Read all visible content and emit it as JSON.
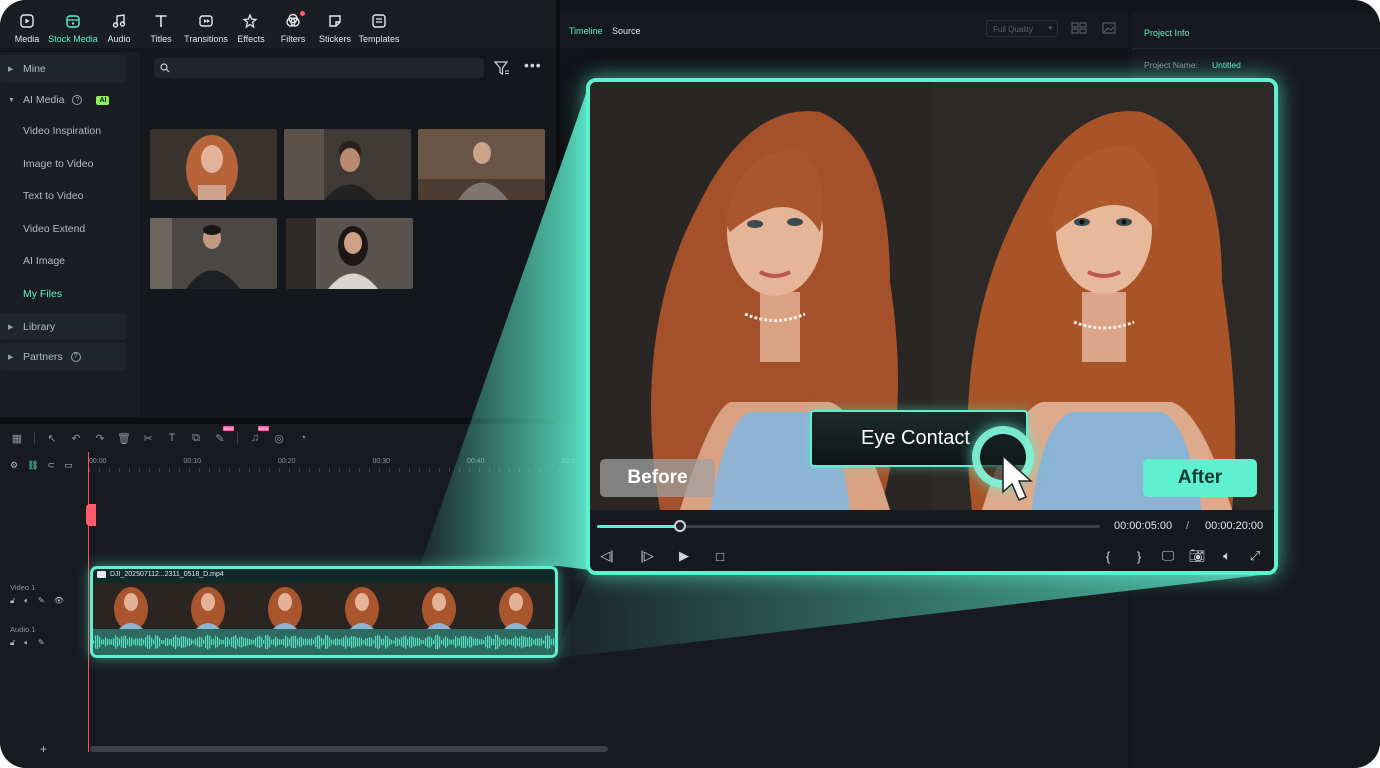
{
  "toolbar": {
    "tabs": [
      {
        "label": "Media",
        "icon": "media-icon"
      },
      {
        "label": "Stock Media",
        "icon": "stock-media-icon",
        "active": true
      },
      {
        "label": "Audio",
        "icon": "music-note-icon"
      },
      {
        "label": "Titles",
        "icon": "text-t-icon"
      },
      {
        "label": "Transitions",
        "icon": "transition-icon"
      },
      {
        "label": "Effects",
        "icon": "sparkle-star-icon"
      },
      {
        "label": "Filters",
        "icon": "filter-icon",
        "dot": true
      },
      {
        "label": "Stickers",
        "icon": "sticker-icon"
      },
      {
        "label": "Templates",
        "icon": "template-icon"
      }
    ]
  },
  "sidebar": {
    "mine": "Mine",
    "ai_media": "AI Media",
    "ai_badge": "AI",
    "items": [
      "Video Inspiration",
      "Image to Video",
      "Text to Video",
      "Video Extend",
      "AI Image",
      "My Files"
    ],
    "selected": "My Files",
    "library": "Library",
    "partners": "Partners"
  },
  "player": {
    "tab_timeline": "Timeline",
    "tab_source": "Source",
    "quality": "Full Quality"
  },
  "project_info": {
    "header": "Project Info",
    "name_label": "Project Name:",
    "name_value": "Untitled"
  },
  "timeline": {
    "ruler_labels": [
      "00:00",
      "00:10",
      "00:20",
      "00:30",
      "00:40",
      "00:50"
    ],
    "video_track": "Video 1",
    "audio_track": "Audio 1",
    "clip_name": "DJI_202507112...2311_0518_D.mp4",
    "new_badge": "NEW"
  },
  "compare": {
    "before_label": "Before",
    "after_label": "After",
    "feature_button": "Eye Contact",
    "current_time": "00:00:05:00",
    "separator": "/",
    "total_time": "00:00:20:00",
    "progress_fraction": 0.25
  },
  "colors": {
    "accent": "#5ef0cf",
    "background": "#121519",
    "playhead": "#ff4d5a"
  }
}
